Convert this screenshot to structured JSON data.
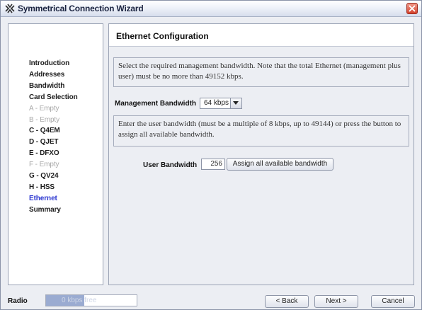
{
  "window": {
    "title": "Symmetrical Connection Wizard"
  },
  "nav": {
    "items": [
      {
        "label": "Introduction",
        "state": "normal"
      },
      {
        "label": "Addresses",
        "state": "normal"
      },
      {
        "label": "Bandwidth",
        "state": "normal"
      },
      {
        "label": "Card Selection",
        "state": "normal"
      },
      {
        "label": "A - Empty",
        "state": "disabled"
      },
      {
        "label": "B - Empty",
        "state": "disabled"
      },
      {
        "label": "C - Q4EM",
        "state": "normal"
      },
      {
        "label": "D - QJET",
        "state": "normal"
      },
      {
        "label": "E - DFXO",
        "state": "normal"
      },
      {
        "label": "F - Empty",
        "state": "disabled"
      },
      {
        "label": "G - QV24",
        "state": "normal"
      },
      {
        "label": "H - HSS",
        "state": "normal"
      },
      {
        "label": "Ethernet",
        "state": "current"
      },
      {
        "label": "Summary",
        "state": "normal"
      }
    ]
  },
  "page": {
    "title": "Ethernet Configuration",
    "info1": "Select the required management bandwidth. Note that the total Ethernet (management plus user) must be no more than 49152 kbps.",
    "mgmt_label": "Management Bandwidth",
    "mgmt_value": "64 kbps",
    "info2": "Enter the user bandwidth (must be a multiple of 8 kbps, up to 49144) or press the button to assign all available bandwidth.",
    "user_label": "User Bandwidth",
    "user_value": "256",
    "assign_button": "Assign all available bandwidth"
  },
  "bottom": {
    "radio_label": "Radio",
    "radio_text": "0 kbps free",
    "radio_fill_fraction": 0.42,
    "back_button": "< Back",
    "next_button": "Next >",
    "cancel_button": "Cancel"
  },
  "colors": {
    "accent": "#2a35d0",
    "fill": "#9aabd1"
  }
}
